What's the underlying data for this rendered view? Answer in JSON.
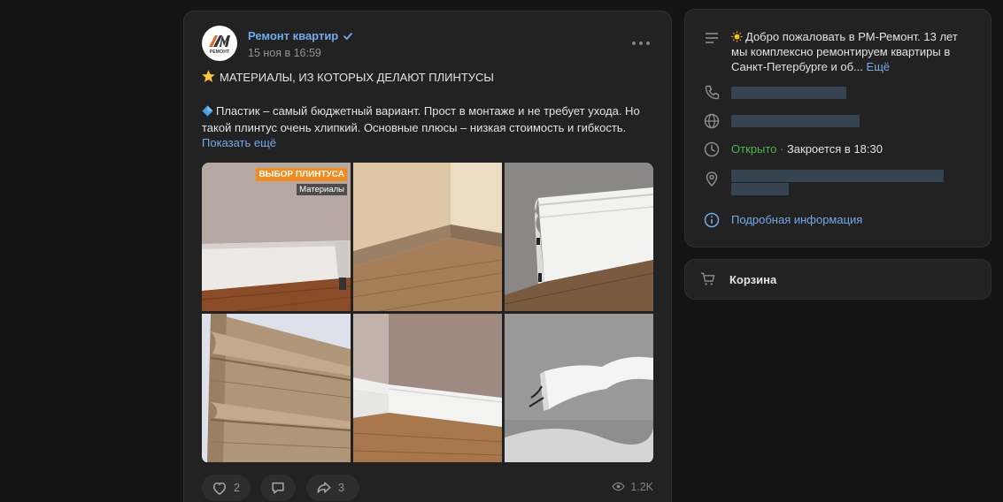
{
  "post": {
    "author": "Ремонт квартир",
    "date": "15 ноя в 16:59",
    "avatar_text": "РЕМОНТ",
    "title": "МАТЕРИАЛЫ, ИЗ КОТОРЫХ ДЕЛАЮТ ПЛИНТУСЫ",
    "body": "Пластик – самый бюджетный вариант. Прост в монтаже и не требует ухода. Но такой плинтус очень хлипкий. Основные плюсы – низкая стоимость и гибкость.",
    "show_more": "Показать ещё",
    "photo_badge_primary": "ВЫБОР ПЛИНТУСА",
    "photo_badge_secondary": "Материалы",
    "likes": "2",
    "reposts": "3",
    "views": "1.2K"
  },
  "sidebar": {
    "description": "Добро пожаловать в РМ-Ремонт. 13 лет мы комплексно ремонтируем квартиры в Санкт-Петербурге и об...",
    "description_more": "Ещё",
    "status_open": "Открыто",
    "status_close": "Закроется в 18:30",
    "details_link": "Подробная информация",
    "cart": "Корзина"
  },
  "colors": {
    "accent": "#71aaeb",
    "open": "#4bb34b",
    "background": "#141414",
    "card": "#222222"
  }
}
